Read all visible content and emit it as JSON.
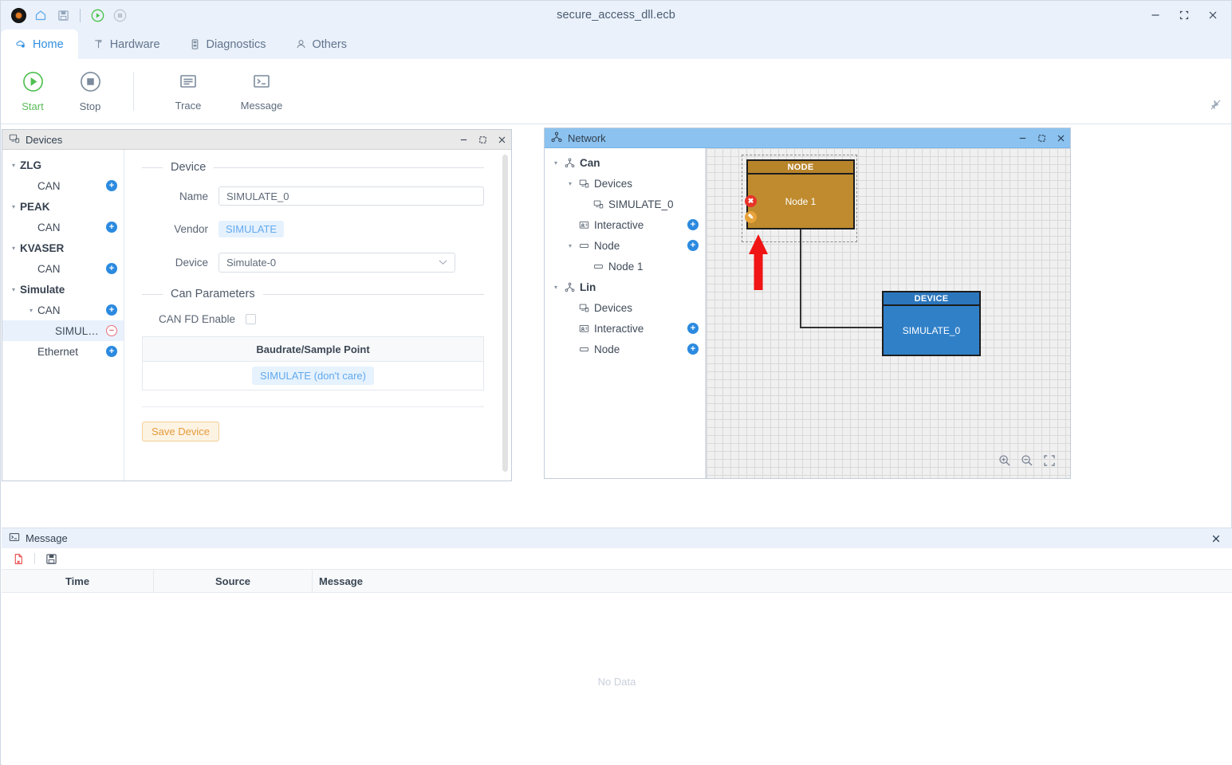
{
  "window": {
    "title": "secure_access_dll.ecb",
    "controls": {
      "minimize": "–",
      "maximize": "❐",
      "close": "✕"
    },
    "quick_icons": [
      "app-logo-icon",
      "home-icon",
      "save-icon",
      "run-icon",
      "stop-icon"
    ]
  },
  "tabs": [
    {
      "label": "Home",
      "icon": "home-cloud-icon",
      "active": true
    },
    {
      "label": "Hardware",
      "icon": "hardware-icon",
      "active": false
    },
    {
      "label": "Diagnostics",
      "icon": "diagnostics-icon",
      "active": false
    },
    {
      "label": "Others",
      "icon": "person-icon",
      "active": false
    }
  ],
  "ribbon": {
    "start": {
      "label": "Start",
      "icon": "play-circle-icon"
    },
    "stop": {
      "label": "Stop",
      "icon": "stop-circle-icon"
    },
    "trace": {
      "label": "Trace",
      "icon": "trace-icon"
    },
    "message": {
      "label": "Message",
      "icon": "console-icon"
    },
    "pin": {
      "icon": "unpin-icon"
    }
  },
  "devices_panel": {
    "title": "Devices",
    "icon": "device-icon",
    "tree": [
      {
        "label": "ZLG",
        "level": 0,
        "group": true,
        "caret": "▾",
        "action": "plus",
        "selected": false,
        "has_action": false
      },
      {
        "label": "CAN",
        "level": 1,
        "group": false,
        "caret": "",
        "action": "plus",
        "selected": false,
        "has_action": true
      },
      {
        "label": "PEAK",
        "level": 0,
        "group": true,
        "caret": "▾",
        "action": "plus",
        "selected": false,
        "has_action": false
      },
      {
        "label": "CAN",
        "level": 1,
        "group": false,
        "caret": "",
        "action": "plus",
        "selected": false,
        "has_action": true
      },
      {
        "label": "KVASER",
        "level": 0,
        "group": true,
        "caret": "▾",
        "action": "plus",
        "selected": false,
        "has_action": false
      },
      {
        "label": "CAN",
        "level": 1,
        "group": false,
        "caret": "",
        "action": "plus",
        "selected": false,
        "has_action": true
      },
      {
        "label": "Simulate",
        "level": 0,
        "group": true,
        "caret": "▾",
        "action": "plus",
        "selected": false,
        "has_action": false
      },
      {
        "label": "CAN",
        "level": 1,
        "group": false,
        "caret": "▾",
        "action": "plus",
        "selected": false,
        "has_action": true
      },
      {
        "label": "SIMUL…",
        "level": 2,
        "group": false,
        "caret": "",
        "action": "minus",
        "selected": true,
        "has_action": true
      },
      {
        "label": "Ethernet",
        "level": 1,
        "group": false,
        "caret": "",
        "action": "plus",
        "selected": false,
        "has_action": true
      }
    ],
    "form": {
      "device_legend": "Device",
      "name_label": "Name",
      "name_value": "SIMULATE_0",
      "name_placeholder": "SIMULATE_0",
      "vendor_label": "Vendor",
      "vendor_value": "SIMULATE",
      "device_label": "Device",
      "device_value": "Simulate-0",
      "can_params_legend": "Can Parameters",
      "canfd_label": "CAN FD Enable",
      "canfd_checked": false,
      "table_header": "Baudrate/Sample Point",
      "table_value": "SIMULATE (don't care)",
      "save_label": "Save Device"
    }
  },
  "network_panel": {
    "title": "Network",
    "icon": "network-icon",
    "tree": [
      {
        "label": "Can",
        "level": 0,
        "group": true,
        "caret": "▾",
        "icon": "network-icon",
        "action": "none"
      },
      {
        "label": "Devices",
        "level": 1,
        "group": false,
        "caret": "▾",
        "icon": "device-icon",
        "action": "none"
      },
      {
        "label": "SIMULATE_0",
        "level": 2,
        "group": false,
        "caret": "",
        "icon": "device-icon",
        "action": "none"
      },
      {
        "label": "Interactive",
        "level": 1,
        "group": false,
        "caret": "",
        "icon": "interactive-icon",
        "action": "plus"
      },
      {
        "label": "Node",
        "level": 1,
        "group": false,
        "caret": "▾",
        "icon": "node-icon",
        "action": "plus"
      },
      {
        "label": "Node 1",
        "level": 2,
        "group": false,
        "caret": "",
        "icon": "node-icon",
        "action": "none"
      },
      {
        "label": "Lin",
        "level": 0,
        "group": true,
        "caret": "▾",
        "icon": "network-icon",
        "action": "none"
      },
      {
        "label": "Devices",
        "level": 1,
        "group": false,
        "caret": "",
        "icon": "device-icon",
        "action": "none"
      },
      {
        "label": "Interactive",
        "level": 1,
        "group": false,
        "caret": "",
        "icon": "interactive-icon",
        "action": "plus"
      },
      {
        "label": "Node",
        "level": 1,
        "group": false,
        "caret": "",
        "icon": "node-icon",
        "action": "plus"
      }
    ],
    "canvas": {
      "node_block": {
        "header": "NODE",
        "label": "Node 1",
        "color": "#bf8b2e",
        "selected": true
      },
      "device_block": {
        "header": "DEVICE",
        "label": "SIMULATE_0",
        "color": "#3080c8"
      },
      "badges": {
        "delete": "✖",
        "edit": "✎"
      },
      "zoom_controls": [
        "zoom-in-icon",
        "zoom-out-icon",
        "fit-screen-icon"
      ]
    }
  },
  "message_panel": {
    "title": "Message",
    "icon": "console-icon",
    "toolbar": [
      "clear-messages-icon",
      "save-messages-icon"
    ],
    "columns": [
      "Time",
      "Source",
      "Message"
    ],
    "rows": [],
    "empty_text": "No Data",
    "close": "✕"
  }
}
